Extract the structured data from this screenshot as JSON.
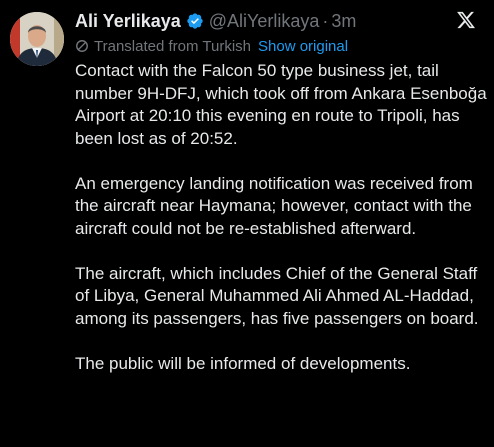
{
  "author": {
    "display_name": "Ali Yerlikaya",
    "handle": "@AliYerlikaya",
    "separator": "·",
    "time": "3m",
    "verified_color": "#1d9bf0"
  },
  "translation": {
    "label": "Translated from Turkish",
    "show_original": "Show original"
  },
  "tweet": {
    "paragraphs": [
      "Contact with the Falcon 50 type business jet, tail number 9H-DFJ, which took off from Ankara Esenboğa Airport at 20:10 this evening en route to Tripoli, has been lost as of 20:52.",
      "An emergency landing notification was received from the aircraft near Haymana; however, contact with the aircraft could not be re-established afterward.",
      "The aircraft, which includes Chief of the General Staff of Libya, General Muhammed Ali Ahmed AL-Haddad, among its passengers, has five passengers on board.",
      "The public will be informed of developments."
    ]
  },
  "icons": {
    "avatar": "avatar",
    "verified": "verified-badge-icon",
    "translate": "translate-icon",
    "logo": "x-logo-icon"
  },
  "colors": {
    "background": "#000000",
    "text": "#e7e9ea",
    "muted": "#71767b",
    "link": "#1d9bf0"
  }
}
